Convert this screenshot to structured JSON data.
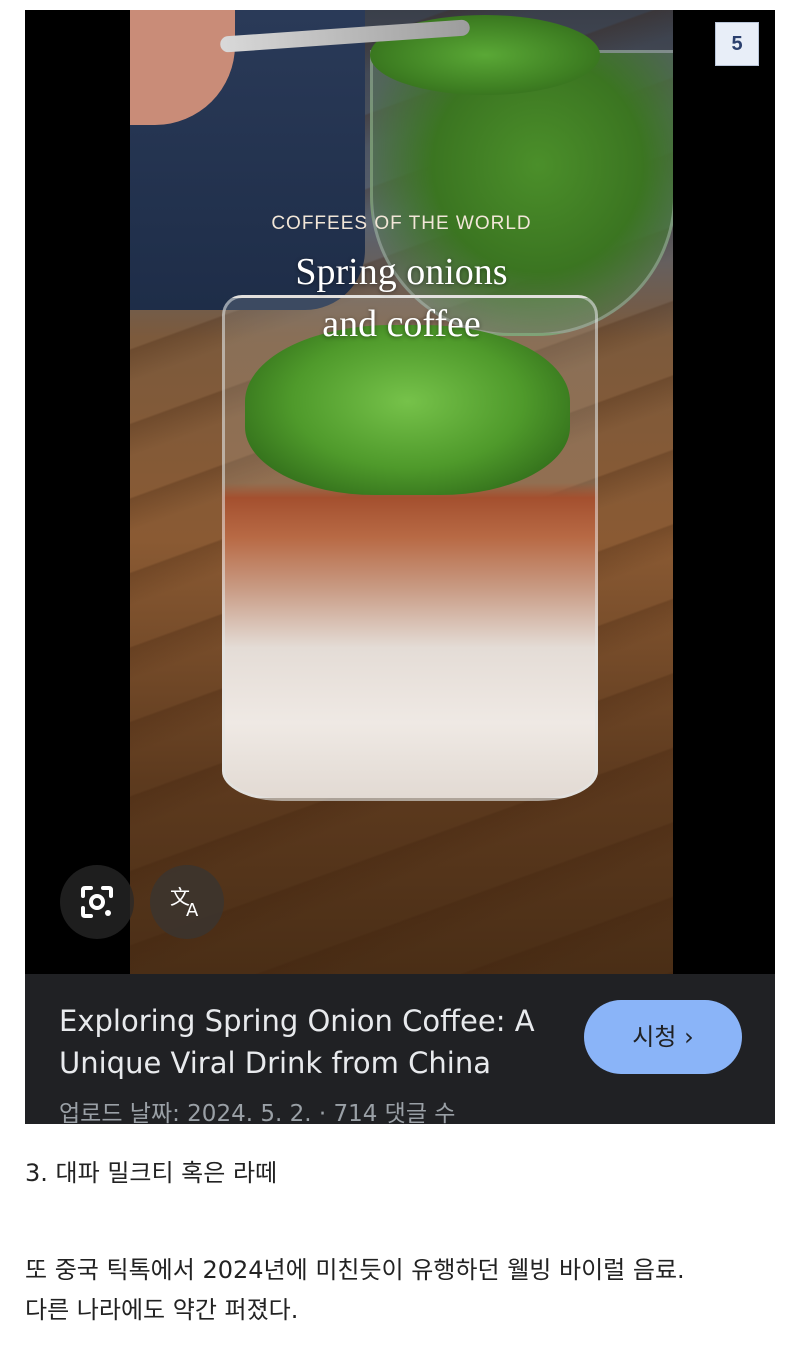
{
  "image_badge": "5",
  "video": {
    "overlay_kicker": "COFFEES OF THE WORLD",
    "overlay_title_line1": "Spring onions",
    "overlay_title_line2": "and coffee",
    "title": "Exploring Spring Onion Coffee: A Unique Viral Drink from China",
    "meta": "업로드 날짜: 2024. 5. 2. · 714 댓글 수",
    "watch_label": "시청 ›",
    "icons": [
      "google-lens-icon",
      "translate-icon"
    ]
  },
  "article": {
    "heading": "3. 대파 밀크티 혹은 라떼",
    "body_line1": "또 중국 틱톡에서 2024년에 미친듯이 유행하던 웰빙 바이럴 음료.",
    "body_line2": "다른 나라에도 약간 퍼졌다."
  },
  "colors": {
    "panel_bg": "#202124",
    "watch_button": "#8ab4f8",
    "badge_text": "#2a3f6e"
  }
}
